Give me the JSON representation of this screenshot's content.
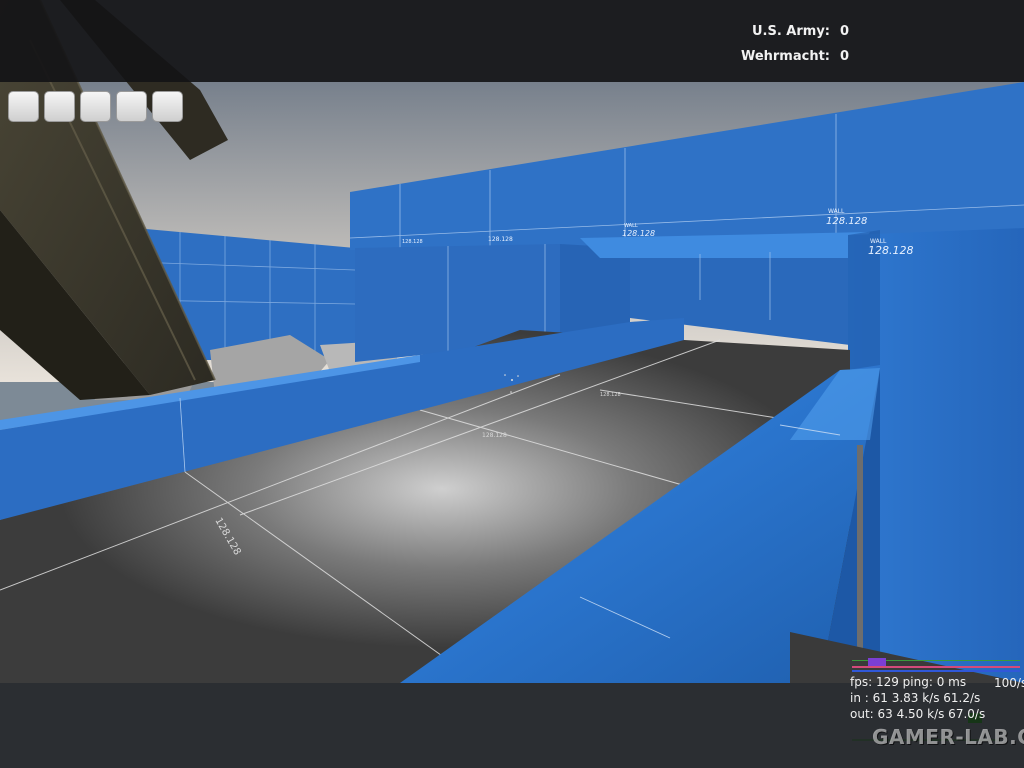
{
  "scoreboard": {
    "teams": [
      {
        "label": "U.S. Army:",
        "score": "0"
      },
      {
        "label": "Wehrmacht:",
        "score": "0"
      }
    ]
  },
  "inventory": {
    "slots": 5
  },
  "world_labels": {
    "wall_tag": "WALL",
    "texture_size": "128.128"
  },
  "netgraph": {
    "line1": "fps: 129  ping: 0 ms",
    "rate": "100/s",
    "line2": "in :  61   3.83 k/s  61.2/s",
    "line3": "out:  63   4.50 k/s  67.0/s"
  },
  "watermark": "GAMER-LAB.COM",
  "colors": {
    "wall_blue": "#2d6fc0",
    "floor": "#4a4a4a",
    "hud_bar": "#141416"
  }
}
